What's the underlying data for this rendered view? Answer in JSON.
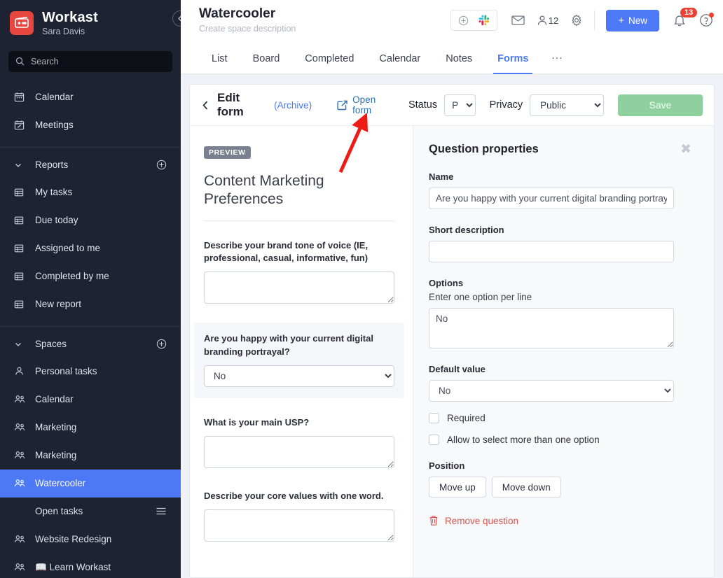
{
  "sidebar": {
    "brand": {
      "name": "Workast",
      "user": "Sara Davis",
      "logo_color": "#e8473f"
    },
    "collapse_icon": "chevron-left-icon",
    "search": {
      "placeholder": "Search",
      "icon": "search-icon"
    },
    "primary_items": [
      {
        "label": "Calendar",
        "icon": "calendar-icon"
      },
      {
        "label": "Meetings",
        "icon": "meetings-icon"
      }
    ],
    "reports": {
      "title": "Reports",
      "add_icon": "plus-circle-icon",
      "items": [
        {
          "label": "My tasks",
          "icon": "table-icon"
        },
        {
          "label": "Due today",
          "icon": "table-icon"
        },
        {
          "label": "Assigned to me",
          "icon": "table-icon"
        },
        {
          "label": "Completed by me",
          "icon": "table-icon"
        },
        {
          "label": "New report",
          "icon": "table-icon"
        }
      ]
    },
    "spaces": {
      "title": "Spaces",
      "add_icon": "plus-circle-icon",
      "items": [
        {
          "label": "Personal tasks",
          "icon": "person-icon",
          "active": false
        },
        {
          "label": "Calendar",
          "icon": "people-icon",
          "active": false
        },
        {
          "label": "Marketing",
          "icon": "people-icon",
          "active": false
        },
        {
          "label": "Marketing",
          "icon": "people-icon",
          "active": false
        },
        {
          "label": "Watercooler",
          "icon": "people-icon",
          "active": true
        },
        {
          "label": "Website Redesign",
          "icon": "people-icon",
          "active": false
        },
        {
          "label": "📖 Learn Workast",
          "icon": "people-icon",
          "active": false
        }
      ],
      "sub_item": {
        "label": "Open tasks",
        "icon": "hamburger-icon"
      },
      "active_color": "#4d79f6"
    }
  },
  "header": {
    "title": "Watercooler",
    "subtitle": "Create space description",
    "integrations": {
      "add_icon": "plus-circle-icon",
      "slack_icon": "slack-icon"
    },
    "mail_icon": "mail-icon",
    "members_icon": "person-icon",
    "members_count": "12",
    "settings_icon": "gear-icon",
    "new_button": {
      "label": "New",
      "icon": "plus-icon",
      "color": "#4d79f6"
    },
    "bell_icon": "bell-icon",
    "bell_badge": "13",
    "help_icon": "help-circle-icon"
  },
  "tabs": [
    {
      "label": "List",
      "active": false
    },
    {
      "label": "Board",
      "active": false
    },
    {
      "label": "Completed",
      "active": false
    },
    {
      "label": "Calendar",
      "active": false
    },
    {
      "label": "Notes",
      "active": false
    },
    {
      "label": "Forms",
      "active": true
    }
  ],
  "tabs_more": "…",
  "form_toolbar": {
    "back_icon": "chevron-left-icon",
    "title": "Edit form",
    "archive_link": "(Archive)",
    "open_form": {
      "label": "Open form",
      "icon": "external-link-icon"
    },
    "status_label": "Status",
    "status_value": "P",
    "status_options": [
      "P"
    ],
    "privacy_label": "Privacy",
    "privacy_value": "Public",
    "privacy_options": [
      "Public"
    ],
    "save_label": "Save",
    "save_color": "#8fd19e"
  },
  "preview": {
    "badge": "PREVIEW",
    "title": "Content Marketing Preferences",
    "questions": [
      {
        "label": "Describe your brand tone of voice (IE, professional, casual, informative, fun)",
        "type": "textarea",
        "value": "",
        "highlight": false
      },
      {
        "label": "Are you happy with your current digital branding portrayal?",
        "type": "select",
        "value": "No",
        "options": [
          "No"
        ],
        "highlight": true
      },
      {
        "label": "What is your main USP?",
        "type": "textarea",
        "value": "",
        "highlight": false
      },
      {
        "label": "Describe your core values with one word.",
        "type": "textarea",
        "value": "",
        "highlight": false
      }
    ]
  },
  "properties": {
    "title": "Question properties",
    "close_icon": "close-icon",
    "name_label": "Name",
    "name_value": "Are you happy with your current digital branding portrayal?",
    "short_description_label": "Short description",
    "short_description_value": "",
    "options_label": "Options",
    "options_hint": "Enter one option per line",
    "options_value": "No",
    "default_value_label": "Default value",
    "default_value": "No",
    "default_value_options": [
      "No"
    ],
    "required_label": "Required",
    "required_checked": false,
    "multi_label": "Allow to select more than one option",
    "multi_checked": false,
    "position_label": "Position",
    "move_up_label": "Move up",
    "move_down_label": "Move down",
    "remove_label": "Remove question",
    "remove_icon": "trash-icon",
    "remove_color": "#d9534f"
  },
  "annotation": {
    "arrow_color": "#ee1c16",
    "points_to": "open-form-link"
  }
}
